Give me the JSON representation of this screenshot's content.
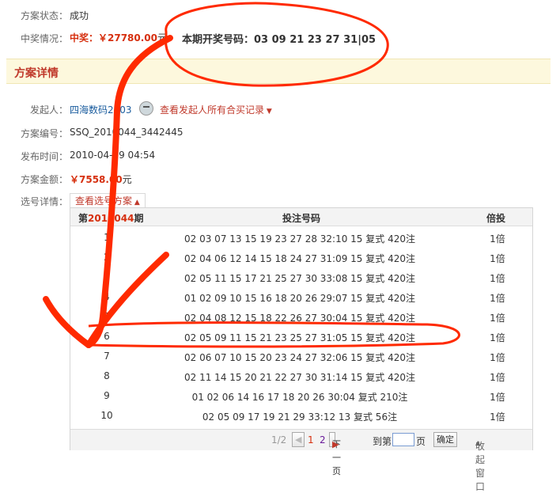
{
  "scheme_status": {
    "label": "方案状态：",
    "value": "成功"
  },
  "prize_info": {
    "label": "中奖情况：",
    "prize_prefix": "中奖：￥27780.00",
    "prize_suffix": "元",
    "draw_label": "本期开奖号码：",
    "draw_numbers": "03 09 21 23 27 31|05"
  },
  "section_title": "方案详情",
  "initiator": {
    "label": "发起人：",
    "name": "四海数码2003",
    "link": "查看发起人所有合买记录"
  },
  "scheme_no": {
    "label": "方案编号：",
    "value": "SSQ_2010044_3442445"
  },
  "publish_time": {
    "label": "发布时间：",
    "value": "2010-04-19 04:54"
  },
  "amount": {
    "label": "方案金额：",
    "value": "￥7558.00",
    "unit": "元"
  },
  "selection": {
    "label": "选号详情：",
    "toggle": "查看选号方案"
  },
  "table": {
    "period_prefix": "第",
    "period": "2010044",
    "period_suffix": "期",
    "col_bet": "投注号码",
    "col_mult": "倍投",
    "rows": [
      {
        "no": "1",
        "bet": "02 03 07 13 15 19 23 27 28 32:10 15 复式 420注",
        "mult": "1倍"
      },
      {
        "no": "2",
        "bet": "02 04 06 12 14 15 18 24 27 31:09 15 复式 420注",
        "mult": "1倍"
      },
      {
        "no": "3",
        "bet": "02 05 11 15 17 21 25 27 30 33:08 15 复式 420注",
        "mult": "1倍"
      },
      {
        "no": "4",
        "bet": "01 02 09 10 15 16 18 20 26 29:07 15 复式 420注",
        "mult": "1倍"
      },
      {
        "no": "5",
        "bet": "02 04 08 12 15 18 22 26 27 30:04 15 复式 420注",
        "mult": "1倍"
      },
      {
        "no": "6",
        "bet": "02 05 09 11 15 21 23 25 27 31:05 15 复式 420注",
        "mult": "1倍"
      },
      {
        "no": "7",
        "bet": "02 06 07 10 15 20 23 24 27 32:06 15 复式 420注",
        "mult": "1倍"
      },
      {
        "no": "8",
        "bet": "02 11 14 15 20 21 22 27 30 31:14 15 复式 420注",
        "mult": "1倍"
      },
      {
        "no": "9",
        "bet": "01 02 06 14 16 17 18 20 26 30:04 复式 210注",
        "mult": "1倍"
      },
      {
        "no": "10",
        "bet": "02 05 09 17 19 21 29 33:12 13 复式 56注",
        "mult": "1倍"
      }
    ]
  },
  "pager": {
    "page_info": "1/2",
    "page1": "1",
    "page2": "2",
    "next": "下一页",
    "goto_prefix": "到第",
    "goto_suffix": "页",
    "confirm": "确定",
    "collapse": "收起窗口"
  }
}
